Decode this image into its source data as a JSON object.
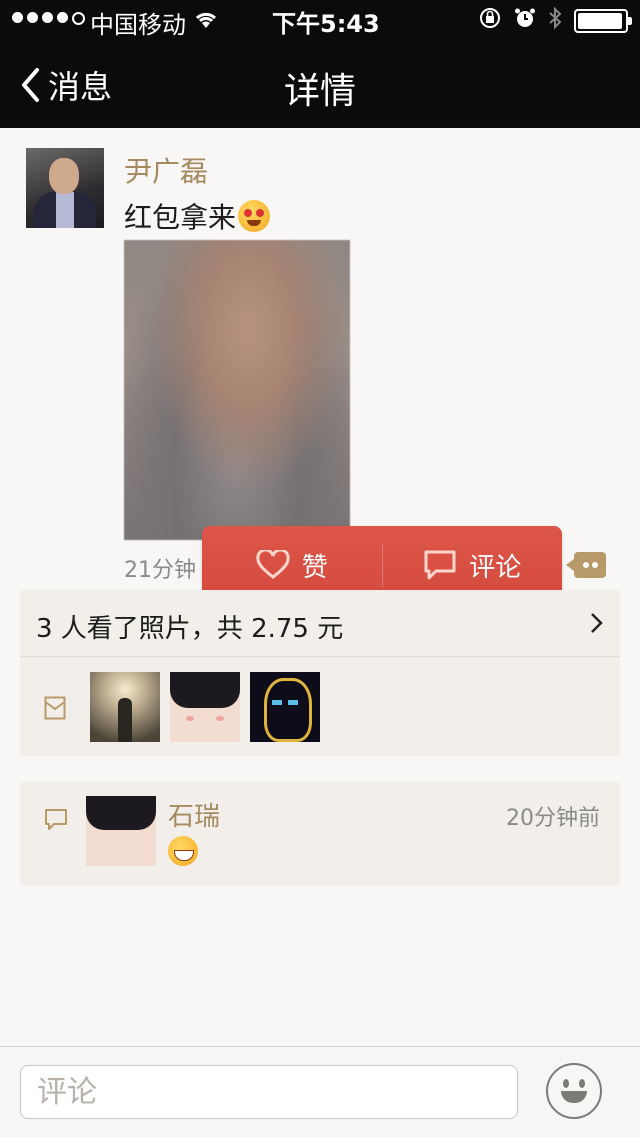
{
  "status_bar": {
    "carrier": "中国移动",
    "time": "下午5:43"
  },
  "nav": {
    "back_label": "消息",
    "title": "详情"
  },
  "post": {
    "author": "尹广磊",
    "text": "红包拿来",
    "time": "21分钟"
  },
  "actions": {
    "like_label": "赞",
    "comment_label": "评论"
  },
  "viewers": {
    "summary": "3 人看了照片，共 2.75 元"
  },
  "comments": [
    {
      "name": "石瑞",
      "time": "20分钟前"
    }
  ],
  "input": {
    "placeholder": "评论"
  },
  "colors": {
    "accent_gold": "#a58a5f",
    "popup_red": "#d94f42",
    "header_bg": "#0b0b0b"
  }
}
